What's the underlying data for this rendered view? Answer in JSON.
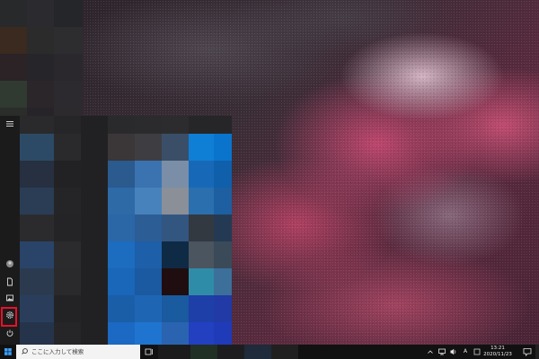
{
  "taskbar": {
    "search_placeholder": "ここに入力して検索",
    "ime_indicator": "A",
    "time": "13:21",
    "date": "2020/11/23"
  },
  "start_menu": {
    "rail_icons": [
      "hamburger-menu-icon",
      "user-account-icon",
      "documents-icon",
      "pictures-icon",
      "settings-icon",
      "power-icon"
    ],
    "highlight_color": "#e8102a"
  },
  "colors": {
    "accent_tile_blue": "#0078d7",
    "taskbar": "#111111",
    "start_menu": "#1f1f1f"
  }
}
